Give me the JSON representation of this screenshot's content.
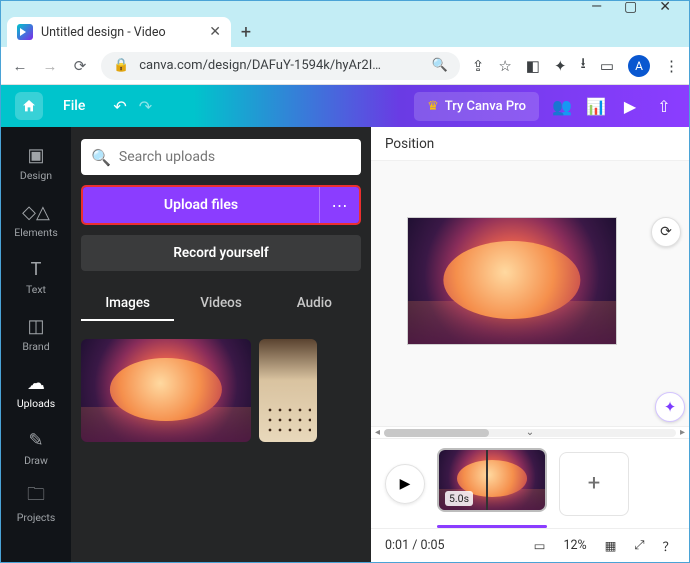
{
  "window": {
    "controls": {
      "min": "—",
      "max": "▢",
      "close": "✕"
    }
  },
  "browser": {
    "tab_title": "Untitled design - Video",
    "url": "canva.com/design/DAFuY-1594k/hyAr2I…",
    "avatar_letter": "A"
  },
  "appbar": {
    "file_label": "File",
    "try_pro_label": "Try Canva Pro"
  },
  "rail": {
    "items": [
      {
        "label": "Design"
      },
      {
        "label": "Elements"
      },
      {
        "label": "Text"
      },
      {
        "label": "Brand"
      },
      {
        "label": "Uploads"
      },
      {
        "label": "Draw"
      },
      {
        "label": "Projects"
      }
    ]
  },
  "panel": {
    "search_placeholder": "Search uploads",
    "upload_label": "Upload files",
    "record_label": "Record yourself",
    "tabs": [
      {
        "label": "Images"
      },
      {
        "label": "Videos"
      },
      {
        "label": "Audio"
      }
    ]
  },
  "canvas": {
    "position_label": "Position"
  },
  "timeline": {
    "clip_duration": "5.0s"
  },
  "bottom": {
    "time_readout": "0:01 / 0:05",
    "zoom_pct": "12%"
  },
  "colors": {
    "accent_purple": "#8b3dff",
    "highlight_red": "#eb2f2f"
  }
}
